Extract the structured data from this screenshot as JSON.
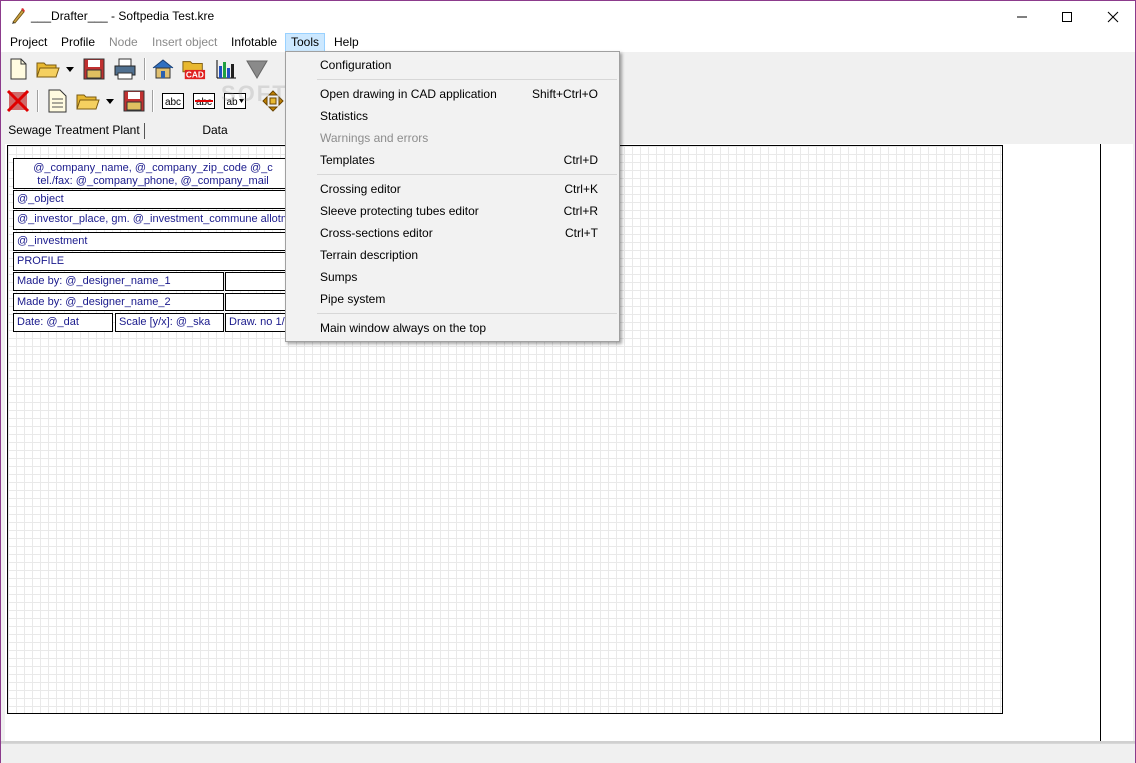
{
  "window": {
    "title": "___Drafter___ - Softpedia Test.kre",
    "app_icon": "pen-icon",
    "controls": [
      "minimize-icon",
      "maximize-icon",
      "close-icon"
    ]
  },
  "menubar": {
    "items": [
      {
        "label": "Project",
        "disabled": false
      },
      {
        "label": "Profile",
        "disabled": false
      },
      {
        "label": "Node",
        "disabled": true
      },
      {
        "label": "Insert object",
        "disabled": true
      },
      {
        "label": "Infotable",
        "disabled": false
      },
      {
        "label": "Tools",
        "disabled": false,
        "active": true
      },
      {
        "label": "Help",
        "disabled": false
      }
    ]
  },
  "toolbar1": {
    "buttons": [
      "new-file-icon",
      "open-folder-icon",
      "dropdown-arrow-icon",
      "save-icon",
      "print-icon",
      "home-icon",
      "cad-icon",
      "bar-chart-icon",
      "funnel-icon"
    ]
  },
  "toolbar2": {
    "buttons": [
      "delete-x-icon",
      "document-icon",
      "open-folder-icon",
      "dropdown-arrow-icon",
      "save-icon",
      "text-abc-icon",
      "text-abc-strike-icon",
      "text-ab-dropdown-icon",
      "move-arrows-icon"
    ]
  },
  "tabs": [
    {
      "label": "Sewage Treatment Plant"
    },
    {
      "label": "Data"
    }
  ],
  "watermark": "SOFTPEDIA",
  "title_block": {
    "company_line1": "@_company_name, @_company_zip_code @_c",
    "company_line2": "tel./fax: @_company_phone, @_company_mail",
    "object": "@_object",
    "investor": "@_investor_place, gm. @_investment_commune allotme",
    "investment": "@_investment",
    "profile": "PROFILE",
    "designer1": "Made by: @_designer_name_1",
    "designer2": "Made by: @_designer_name_2",
    "date": "Date: @_dat",
    "scale": "Scale [y/x]: @_ska",
    "drawing_no": "Draw. no 1/"
  },
  "tools_menu": {
    "items": [
      {
        "label": "Configuration",
        "shortcut": "",
        "disabled": false
      },
      {
        "label": "Open drawing in CAD application",
        "shortcut": "Shift+Ctrl+O",
        "disabled": false
      },
      {
        "label": "Statistics",
        "shortcut": "",
        "disabled": false
      },
      {
        "label": "Warnings and errors",
        "shortcut": "",
        "disabled": true
      },
      {
        "label": "Templates",
        "shortcut": "Ctrl+D",
        "disabled": false
      },
      {
        "label": "Crossing editor",
        "shortcut": "Ctrl+K",
        "disabled": false
      },
      {
        "label": "Sleeve protecting tubes editor",
        "shortcut": "Ctrl+R",
        "disabled": false
      },
      {
        "label": "Cross-sections editor",
        "shortcut": "Ctrl+T",
        "disabled": false
      },
      {
        "label": "Terrain description",
        "shortcut": "",
        "disabled": false
      },
      {
        "label": "Sumps",
        "shortcut": "",
        "disabled": false
      },
      {
        "label": "Pipe system",
        "shortcut": "",
        "disabled": false
      },
      {
        "label": "Main window always on the top",
        "shortcut": "",
        "disabled": false
      }
    ]
  }
}
